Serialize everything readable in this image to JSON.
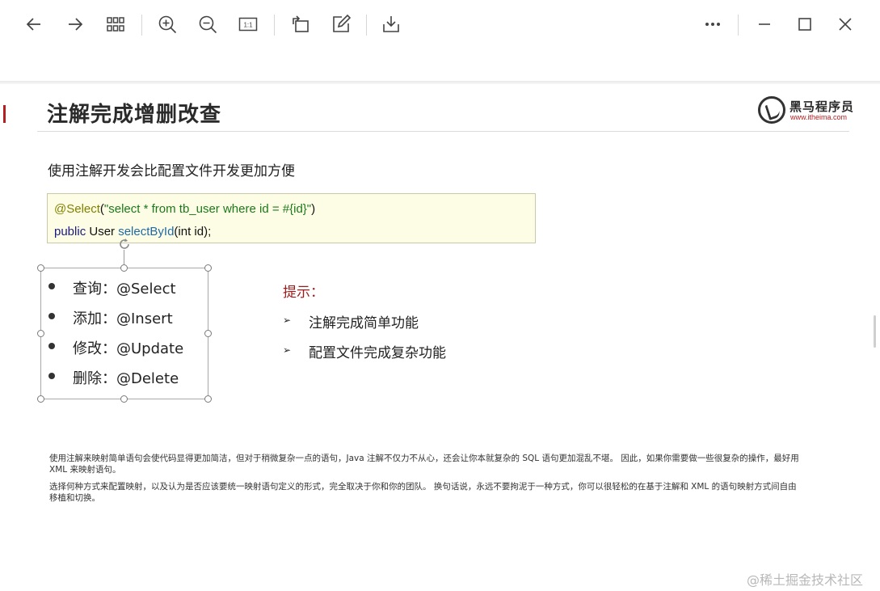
{
  "toolbar": {
    "left_buttons": [
      {
        "name": "back-button",
        "icon": "arrow-left-icon"
      },
      {
        "name": "forward-button",
        "icon": "arrow-right-icon"
      },
      {
        "name": "thumbnails-button",
        "icon": "grid-icon"
      },
      {
        "name": "zoom-in-button",
        "icon": "zoom-in-icon"
      },
      {
        "name": "zoom-out-button",
        "icon": "zoom-out-icon"
      },
      {
        "name": "actual-size-button",
        "icon": "actual-size-icon"
      },
      {
        "name": "rotate-button",
        "icon": "rotate-icon"
      },
      {
        "name": "edit-button",
        "icon": "edit-icon"
      },
      {
        "name": "save-button",
        "icon": "download-icon"
      }
    ],
    "right_buttons": [
      {
        "name": "more-button",
        "icon": "more-icon"
      },
      {
        "name": "minimize-button",
        "icon": "minimize-icon"
      },
      {
        "name": "maximize-button",
        "icon": "maximize-icon"
      },
      {
        "name": "close-button",
        "icon": "close-icon"
      }
    ],
    "actual_size_label": "1:1"
  },
  "slide": {
    "title": "注解完成增删改查",
    "logo": {
      "name": "黑马程序员",
      "url": "www.itheima.com"
    },
    "lead": "使用注解开发会比配置文件开发更加方便",
    "code": {
      "line1": {
        "annotation": "@Select",
        "open": "(",
        "string": "\"select * from tb_user where id = #{id}\"",
        "close": ")"
      },
      "line2": {
        "keyword": "public",
        "type": "User",
        "method": "selectById",
        "params": "(int id);"
      }
    },
    "bullets": [
      "查询：@Select",
      "添加：@Insert",
      "修改：@Update",
      "删除：@Delete"
    ],
    "tip": {
      "title": "提示：",
      "items": [
        "注解完成简单功能",
        "配置文件完成复杂功能"
      ]
    },
    "notes": [
      "使用注解来映射简单语句会使代码显得更加简洁，但对于稍微复杂一点的语句，Java 注解不仅力不从心，还会让你本就复杂的 SQL 语句更加混乱不堪。 因此，如果你需要做一些很复杂的操作，最好用 XML 来映射语句。",
      "选择何种方式来配置映射，以及认为是否应该要统一映射语句定义的形式，完全取决于你和你的团队。 换句话说，永远不要拘泥于一种方式，你可以很轻松的在基于注解和 XML 的语句映射方式间自由移植和切换。"
    ]
  },
  "watermark": "@稀土掘金技术社区",
  "colors": {
    "accent_red": "#9c1c1c",
    "code_bg": "#fdfde6",
    "annotation": "#808000",
    "string": "#1a7a1a",
    "method": "#1f6aa5"
  }
}
